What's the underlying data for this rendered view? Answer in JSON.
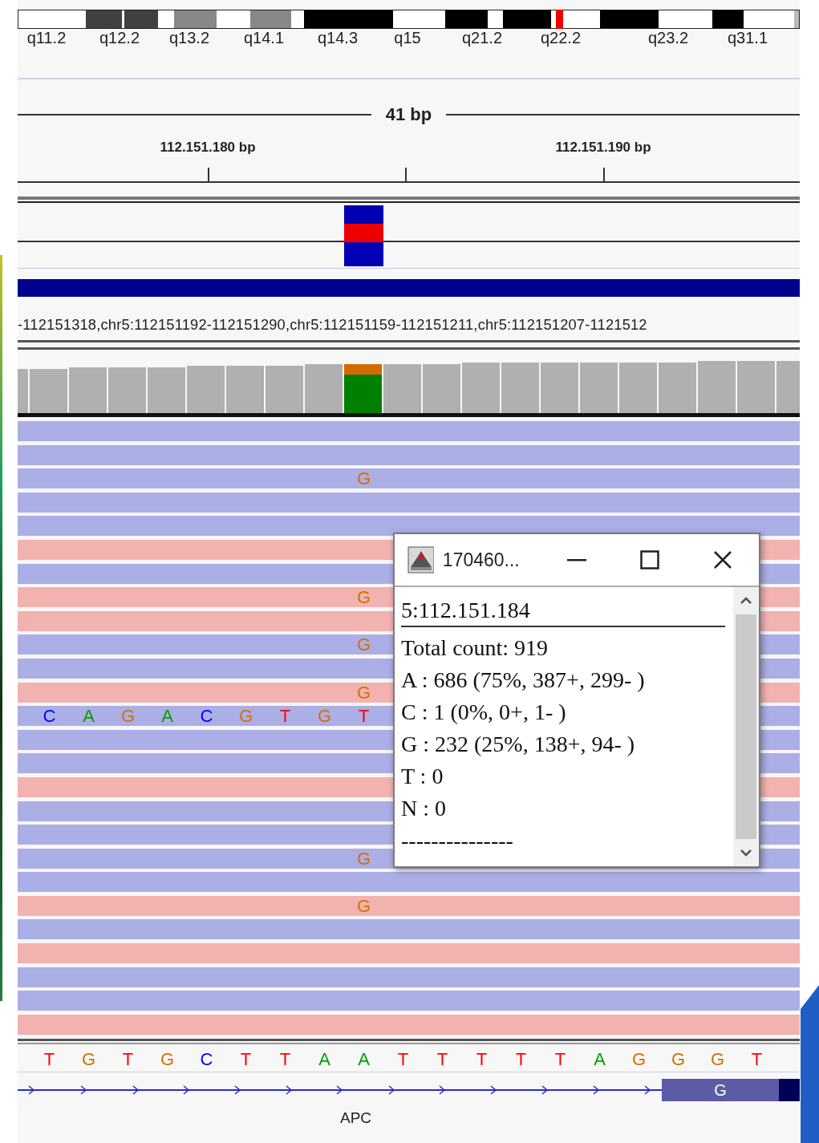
{
  "ideogram": {
    "bands": [
      "q11.2",
      "q12.2",
      "q13.2",
      "q14.1",
      "q14.3",
      "q15",
      "q21.2",
      "q22.2",
      "q23.2",
      "q31.1"
    ]
  },
  "ruler": {
    "span": "41 bp",
    "ticks": [
      "112.151.180 bp",
      "112.151.190 bp"
    ]
  },
  "read_names": "-112151318,chr5:112151192-112151290,chr5:112151159-112151211,chr5:112151207-1121512",
  "reads": [
    {
      "color": "#acaee6"
    },
    {
      "color": "#acaee6"
    },
    {
      "color": "#acaee6",
      "allele": {
        "base": "G",
        "color": "#d17105"
      }
    },
    {
      "color": "#acaee6"
    },
    {
      "color": "#acaee6"
    },
    {
      "color": "#f2b2b0"
    },
    {
      "color": "#acaee6"
    },
    {
      "color": "#f2b2b0",
      "allele": {
        "base": "G",
        "color": "#d17105"
      }
    },
    {
      "color": "#f2b2b0"
    },
    {
      "color": "#acaee6",
      "allele": {
        "base": "G",
        "color": "#d17105"
      }
    },
    {
      "color": "#acaee6"
    },
    {
      "color": "#f2b2b0",
      "allele": {
        "base": "G",
        "color": "#d17105"
      }
    },
    {
      "color": "#acaee6",
      "bases": [
        {
          "base": "C",
          "color": "#0000ff"
        },
        {
          "base": "A",
          "color": "#00a000"
        },
        {
          "base": "G",
          "color": "#d17105"
        },
        {
          "base": "A",
          "color": "#00a000"
        },
        {
          "base": "C",
          "color": "#0000ff"
        },
        {
          "base": "G",
          "color": "#d17105"
        },
        {
          "base": "T",
          "color": "#ff0000"
        },
        {
          "base": "G",
          "color": "#d17105"
        },
        {
          "base": "T",
          "color": "#ff0000"
        }
      ]
    },
    {
      "color": "#acaee6"
    },
    {
      "color": "#acaee6"
    },
    {
      "color": "#f2b2b0"
    },
    {
      "color": "#acaee6"
    },
    {
      "color": "#acaee6"
    },
    {
      "color": "#acaee6",
      "allele": {
        "base": "G",
        "color": "#d17105"
      }
    },
    {
      "color": "#acaee6"
    },
    {
      "color": "#f2b2b0",
      "allele": {
        "base": "G",
        "color": "#d17105"
      }
    },
    {
      "color": "#acaee6"
    },
    {
      "color": "#f2b2b0"
    },
    {
      "color": "#acaee6"
    },
    {
      "color": "#acaee6"
    },
    {
      "color": "#f2b2b0"
    }
  ],
  "sequence": [
    {
      "base": "T",
      "color": "#ff0000"
    },
    {
      "base": "G",
      "color": "#d17105"
    },
    {
      "base": "T",
      "color": "#ff0000"
    },
    {
      "base": "G",
      "color": "#d17105"
    },
    {
      "base": "C",
      "color": "#0000ff"
    },
    {
      "base": "T",
      "color": "#ff0000"
    },
    {
      "base": "T",
      "color": "#ff0000"
    },
    {
      "base": "A",
      "color": "#00a000"
    },
    {
      "base": "A",
      "color": "#00a000"
    },
    {
      "base": "T",
      "color": "#ff0000"
    },
    {
      "base": "T",
      "color": "#ff0000"
    },
    {
      "base": "T",
      "color": "#ff0000"
    },
    {
      "base": "T",
      "color": "#ff0000"
    },
    {
      "base": "T",
      "color": "#ff0000"
    },
    {
      "base": "A",
      "color": "#00a000"
    },
    {
      "base": "G",
      "color": "#d17105"
    },
    {
      "base": "G",
      "color": "#d17105"
    },
    {
      "base": "G",
      "color": "#d17105"
    },
    {
      "base": "T",
      "color": "#ff0000"
    }
  ],
  "gene": {
    "exon_base": "G",
    "name": "APC"
  },
  "popup": {
    "title": "170460...",
    "position": "5:112.151.184",
    "lines": [
      "Total count: 919",
      "A : 686 (75%, 387+, 299- )",
      "C : 1 (0%, 0+, 1- )",
      "G : 232 (25%, 138+, 94- )",
      "T : 0",
      "N : 0"
    ],
    "footer": "---------------"
  }
}
